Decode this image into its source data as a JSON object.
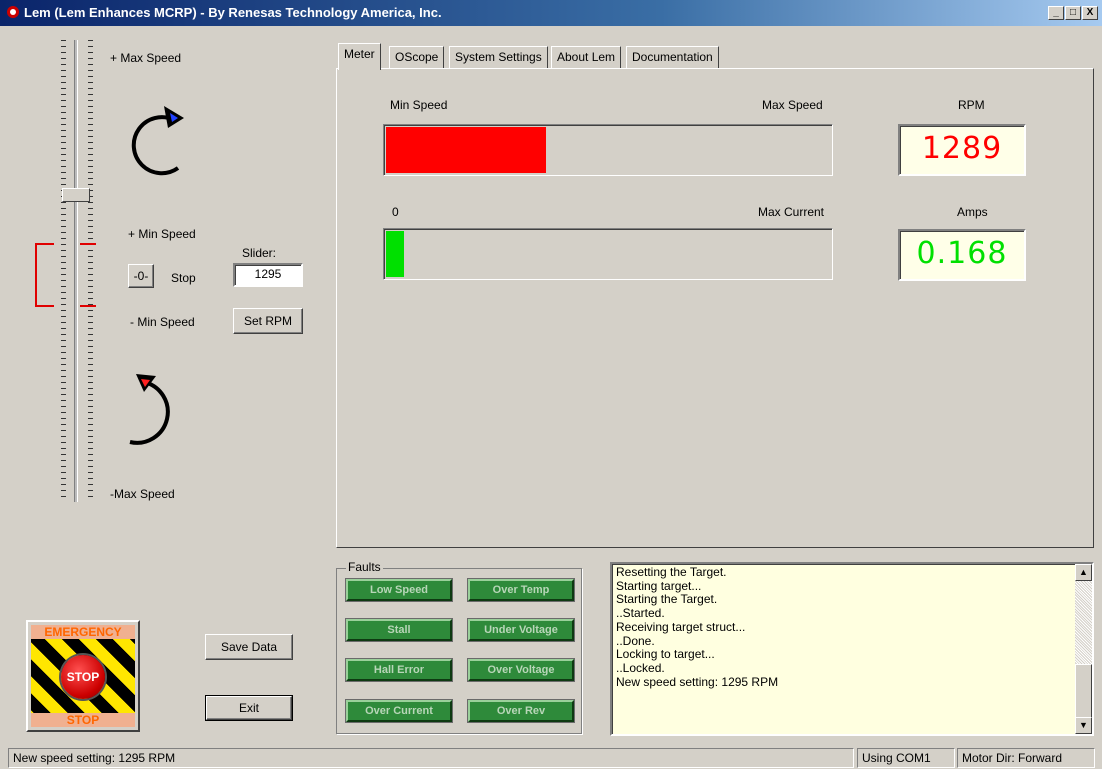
{
  "window": {
    "title": "Lem (Lem Enhances MCRP) - By Renesas Technology America, Inc.",
    "minimize": "_",
    "maximize": "□",
    "close": "X"
  },
  "slider": {
    "max_plus": "+ Max Speed",
    "min_plus": "+ Min Speed",
    "stop_button": "-0-",
    "stop_label": "Stop",
    "min_minus": "- Min Speed",
    "max_minus": "-Max Speed",
    "value_label": "Slider:",
    "value": "1295",
    "set_rpm_button": "Set RPM"
  },
  "tabs": [
    "Meter",
    "OScope",
    "System Settings",
    "About Lem",
    "Documentation"
  ],
  "meter": {
    "speed": {
      "min_label": "Min Speed",
      "max_label": "Max Speed",
      "fill_fraction": 0.36,
      "color": "#ff0000"
    },
    "rpm": {
      "label": "RPM",
      "value": "1289",
      "color": "#ff0000"
    },
    "current": {
      "min_label": "0",
      "max_label": "Max Current",
      "fill_fraction": 0.04,
      "color": "#00e000"
    },
    "amps": {
      "label": "Amps",
      "value": "0.168",
      "color": "#00e000"
    }
  },
  "faults": {
    "legend": "Faults",
    "items": [
      "Low Speed",
      "Over Temp",
      "Stall",
      "Under Voltage",
      "Hall Error",
      "Over Voltage",
      "Over Current",
      "Over Rev"
    ]
  },
  "log": {
    "lines": [
      "Resetting the Target.",
      "Starting target...",
      "Starting the Target.",
      "..Started.",
      "Receiving target struct...",
      "..Done.",
      "Locking to target...",
      "..Locked.",
      "New speed setting: 1295 RPM"
    ]
  },
  "buttons": {
    "save_data": "Save Data",
    "exit": "Exit"
  },
  "estop": {
    "top_text": "EMERGENCY",
    "center_text": "STOP",
    "bottom_text": "STOP"
  },
  "statusbar": {
    "message": "New speed setting: 1295 RPM",
    "port": "Using COM1",
    "motor_dir": "Motor Dir: Forward"
  }
}
